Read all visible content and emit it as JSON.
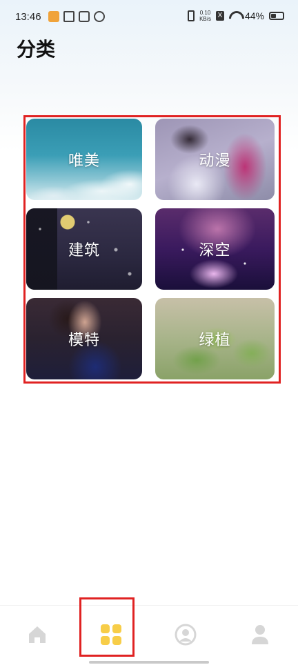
{
  "status_bar": {
    "time": "13:46",
    "net_speed_value": "0.10",
    "net_speed_unit": "KB/s",
    "battery_percent": "44%",
    "battery_level": 0.44,
    "x_badge": "X"
  },
  "page": {
    "title": "分类"
  },
  "categories": [
    {
      "label": "唯美"
    },
    {
      "label": "动漫"
    },
    {
      "label": "建筑"
    },
    {
      "label": "深空"
    },
    {
      "label": "模特"
    },
    {
      "label": "绿植"
    }
  ],
  "bottom_nav": {
    "items": [
      {
        "icon": "home-icon",
        "active": false
      },
      {
        "icon": "category-grid-icon",
        "active": true
      },
      {
        "icon": "explore-circle-icon",
        "active": false
      },
      {
        "icon": "user-icon",
        "active": false
      }
    ],
    "active_color": "#f7cd48",
    "inactive_color": "#d6d6d6"
  },
  "colors": {
    "highlight_frame": "#e02222"
  }
}
